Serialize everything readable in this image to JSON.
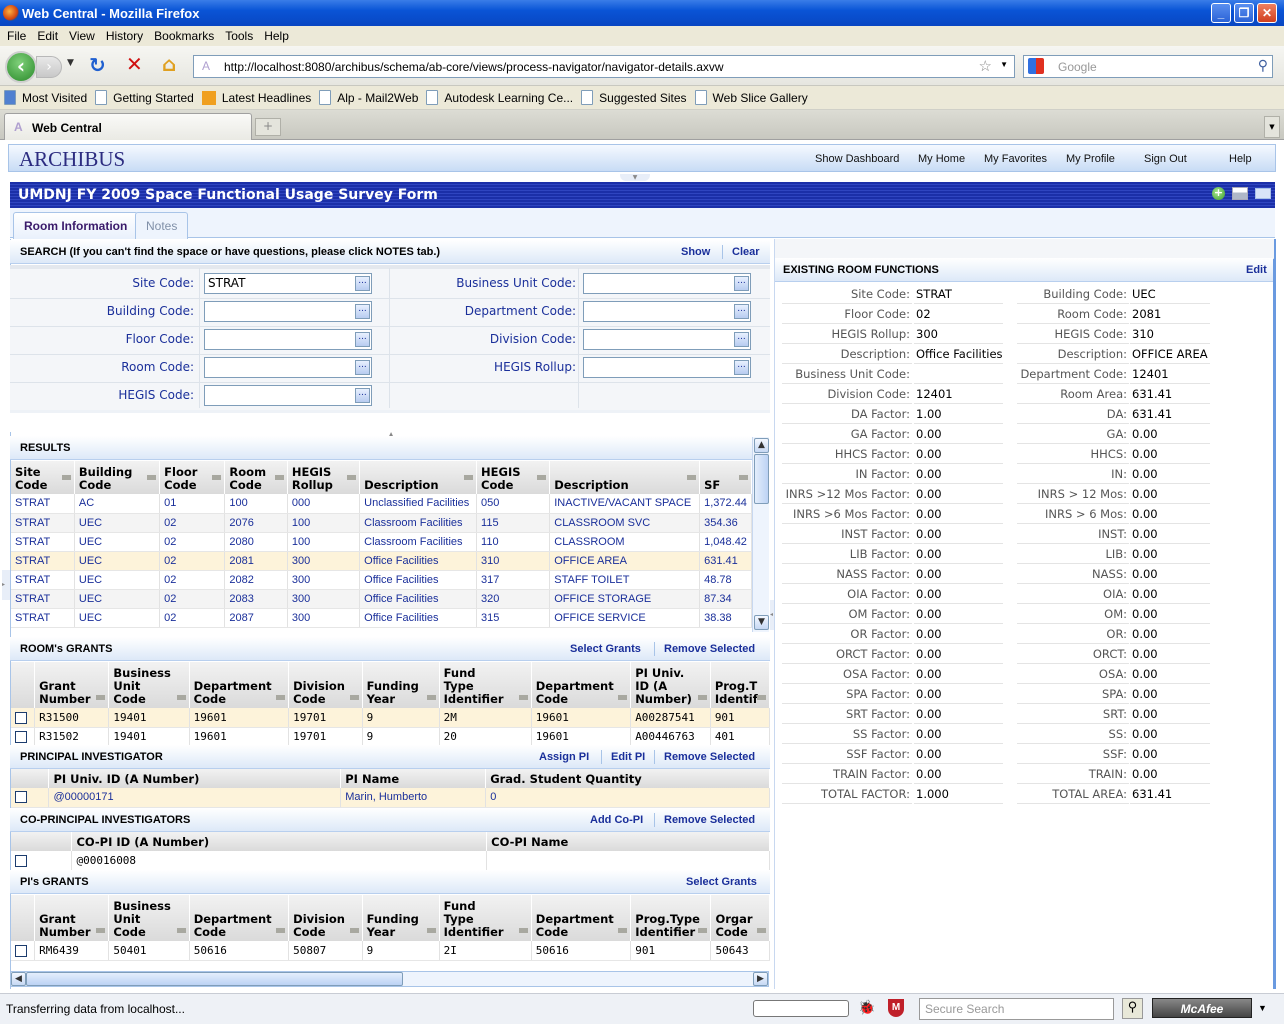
{
  "browser": {
    "window_title": "Web Central - Mozilla Firefox",
    "menu": [
      "File",
      "Edit",
      "View",
      "History",
      "Bookmarks",
      "Tools",
      "Help"
    ],
    "url": "http://localhost:8080/archibus/schema/ab-core/views/process-navigator/navigator-details.axvw",
    "search_placeholder": "Google",
    "bookmarks": [
      "Most Visited",
      "Getting Started",
      "Latest Headlines",
      "Alp - Mail2Web",
      "Autodesk Learning Ce...",
      "Suggested Sites",
      "Web Slice Gallery"
    ],
    "tab_title": "Web Central",
    "status_text": "Transferring data from localhost...",
    "secure_search_placeholder": "Secure Search",
    "mcafee_label": "McAfee"
  },
  "app": {
    "logo": "ARCHIBUS",
    "nav_links": [
      "Show Dashboard",
      "My Home",
      "My Favorites",
      "My Profile",
      "Sign Out",
      "Help"
    ],
    "form_title": "UMDNJ FY 2009 Space Functional Usage Survey Form",
    "tabs": [
      "Room Information",
      "Notes"
    ]
  },
  "search": {
    "title": "SEARCH (If you can't find the space or have questions, please click NOTES tab.)",
    "show_label": "Show",
    "clear_label": "Clear",
    "left_fields": [
      {
        "label": "Site Code:",
        "value": "STRAT"
      },
      {
        "label": "Building Code:",
        "value": ""
      },
      {
        "label": "Floor Code:",
        "value": ""
      },
      {
        "label": "Room Code:",
        "value": ""
      },
      {
        "label": "HEGIS Code:",
        "value": ""
      }
    ],
    "right_fields": [
      {
        "label": "Business Unit Code:",
        "value": ""
      },
      {
        "label": "Department Code:",
        "value": ""
      },
      {
        "label": "Division Code:",
        "value": ""
      },
      {
        "label": "HEGIS Rollup:",
        "value": ""
      }
    ]
  },
  "results": {
    "title": "RESULTS",
    "columns": [
      [
        "Site",
        "Code"
      ],
      [
        "Building",
        "Code"
      ],
      [
        "Floor",
        "Code"
      ],
      [
        "Room",
        "Code"
      ],
      [
        "HEGIS",
        "Rollup"
      ],
      [
        "",
        "Description"
      ],
      [
        "HEGIS",
        "Code"
      ],
      [
        "",
        "Description"
      ],
      [
        "",
        "SF"
      ]
    ],
    "rows": [
      [
        "STRAT",
        "AC",
        "01",
        "100",
        "000",
        "Unclassified Facilities",
        "050",
        "INACTIVE/VACANT SPACE",
        "1,372.44"
      ],
      [
        "STRAT",
        "UEC",
        "02",
        "2076",
        "100",
        "Classroom Facilities",
        "115",
        "CLASSROOM SVC",
        "354.36"
      ],
      [
        "STRAT",
        "UEC",
        "02",
        "2080",
        "100",
        "Classroom Facilities",
        "110",
        "CLASSROOM",
        "1,048.42"
      ],
      [
        "STRAT",
        "UEC",
        "02",
        "2081",
        "300",
        "Office Facilities",
        "310",
        "OFFICE AREA",
        "631.41"
      ],
      [
        "STRAT",
        "UEC",
        "02",
        "2082",
        "300",
        "Office Facilities",
        "317",
        "STAFF TOILET",
        "48.78"
      ],
      [
        "STRAT",
        "UEC",
        "02",
        "2083",
        "300",
        "Office Facilities",
        "320",
        "OFFICE STORAGE",
        "87.34"
      ],
      [
        "STRAT",
        "UEC",
        "02",
        "2087",
        "300",
        "Office Facilities",
        "315",
        "OFFICE SERVICE",
        "38.38"
      ]
    ],
    "selected_row": 3
  },
  "room_grants": {
    "title": "ROOM's GRANTS",
    "select_label": "Select Grants",
    "remove_label": "Remove Selected",
    "columns": [
      [
        "",
        "Grant",
        "Number"
      ],
      [
        "Business",
        "Unit",
        "Code"
      ],
      [
        "",
        "Department",
        "Code"
      ],
      [
        "",
        "Division",
        "Code"
      ],
      [
        "",
        "Funding",
        "Year"
      ],
      [
        "Fund",
        "Type",
        "Identifier"
      ],
      [
        "",
        "Department",
        "Code"
      ],
      [
        "PI Univ.",
        "ID (A",
        "Number)"
      ],
      [
        "",
        "Prog.T",
        "Identif"
      ]
    ],
    "rows": [
      [
        "R31500",
        "19401",
        "19601",
        "19701",
        "9",
        "2M",
        "19601",
        "A00287541",
        "901"
      ],
      [
        "R31502",
        "19401",
        "19601",
        "19701",
        "9",
        "20",
        "19601",
        "A00446763",
        "401"
      ]
    ]
  },
  "pi": {
    "title": "PRINCIPAL INVESTIGATOR",
    "assign_label": "Assign PI",
    "edit_label": "Edit PI",
    "remove_label": "Remove Selected",
    "columns": [
      "PI Univ. ID (A Number)",
      "PI Name",
      "Grad. Student Quantity"
    ],
    "rows": [
      [
        "@00000171",
        "Marin, Humberto",
        "0"
      ]
    ]
  },
  "co_pi": {
    "title": "CO-PRINCIPAL INVESTIGATORS",
    "add_label": "Add Co-PI",
    "remove_label": "Remove Selected",
    "columns": [
      "CO-PI ID (A Number)",
      "CO-PI Name"
    ],
    "rows": [
      [
        "@00016008",
        ""
      ]
    ]
  },
  "pi_grants": {
    "title": "PI's GRANTS",
    "select_label": "Select Grants",
    "columns": [
      [
        "",
        "Grant",
        "Number"
      ],
      [
        "Business",
        "Unit",
        "Code"
      ],
      [
        "",
        "Department",
        "Code"
      ],
      [
        "",
        "Division",
        "Code"
      ],
      [
        "",
        "Funding",
        "Year"
      ],
      [
        "Fund",
        "Type",
        "Identifier"
      ],
      [
        "",
        "Department",
        "Code"
      ],
      [
        "",
        "Prog.Type",
        "Identifier"
      ],
      [
        "",
        "Orgar",
        "Code"
      ]
    ],
    "rows": [
      [
        "RM6439",
        "50401",
        "50616",
        "50807",
        "9",
        "2I",
        "50616",
        "901",
        "50643"
      ]
    ]
  },
  "existing": {
    "title": "EXISTING ROOM FUNCTIONS",
    "edit_label": "Edit",
    "left": [
      [
        "Site Code:",
        "STRAT"
      ],
      [
        "Floor Code:",
        "02"
      ],
      [
        "HEGIS Rollup:",
        "300"
      ],
      [
        "Description:",
        "Office Facilities"
      ],
      [
        "Business Unit Code:",
        ""
      ],
      [
        "Division Code:",
        "12401"
      ],
      [
        "DA Factor:",
        "1.00"
      ],
      [
        "GA Factor:",
        "0.00"
      ],
      [
        "HHCS Factor:",
        "0.00"
      ],
      [
        "IN Factor:",
        "0.00"
      ],
      [
        "INRS >12 Mos Factor:",
        "0.00"
      ],
      [
        "INRS >6 Mos Factor:",
        "0.00"
      ],
      [
        "INST Factor:",
        "0.00"
      ],
      [
        "LIB Factor:",
        "0.00"
      ],
      [
        "NASS Factor:",
        "0.00"
      ],
      [
        "OIA Factor:",
        "0.00"
      ],
      [
        "OM Factor:",
        "0.00"
      ],
      [
        "OR Factor:",
        "0.00"
      ],
      [
        "ORCT Factor:",
        "0.00"
      ],
      [
        "OSA Factor:",
        "0.00"
      ],
      [
        "SPA Factor:",
        "0.00"
      ],
      [
        "SRT Factor:",
        "0.00"
      ],
      [
        "SS Factor:",
        "0.00"
      ],
      [
        "SSF Factor:",
        "0.00"
      ],
      [
        "TRAIN Factor:",
        "0.00"
      ],
      [
        "TOTAL FACTOR:",
        "1.000"
      ]
    ],
    "right": [
      [
        "Building Code:",
        "UEC"
      ],
      [
        "Room Code:",
        "2081"
      ],
      [
        "HEGIS Code:",
        "310"
      ],
      [
        "Description:",
        "OFFICE AREA"
      ],
      [
        "Department Code:",
        "12401"
      ],
      [
        "Room Area:",
        "631.41"
      ],
      [
        "DA:",
        "631.41"
      ],
      [
        "GA:",
        "0.00"
      ],
      [
        "HHCS:",
        "0.00"
      ],
      [
        "IN:",
        "0.00"
      ],
      [
        "INRS > 12 Mos:",
        "0.00"
      ],
      [
        "INRS > 6 Mos:",
        "0.00"
      ],
      [
        "INST:",
        "0.00"
      ],
      [
        "LIB:",
        "0.00"
      ],
      [
        "NASS:",
        "0.00"
      ],
      [
        "OIA:",
        "0.00"
      ],
      [
        "OM:",
        "0.00"
      ],
      [
        "OR:",
        "0.00"
      ],
      [
        "ORCT:",
        "0.00"
      ],
      [
        "OSA:",
        "0.00"
      ],
      [
        "SPA:",
        "0.00"
      ],
      [
        "SRT:",
        "0.00"
      ],
      [
        "SS:",
        "0.00"
      ],
      [
        "SSF:",
        "0.00"
      ],
      [
        "TRAIN:",
        "0.00"
      ],
      [
        "TOTAL AREA:",
        "631.41"
      ]
    ]
  }
}
